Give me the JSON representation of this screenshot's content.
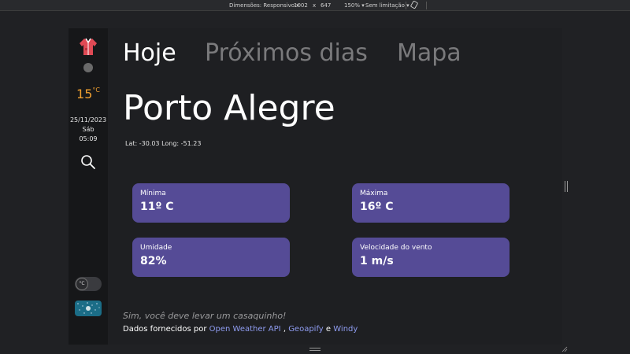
{
  "devtools": {
    "dimensions_label": "Dimensões: Responsivo",
    "width": "1002",
    "times": "x",
    "height": "647",
    "zoom": "150%",
    "throttle": "Sem limitação"
  },
  "sidebar": {
    "temperature": "15",
    "temperature_unit": "°C",
    "date": "25/11/2023",
    "weekday": "Sáb",
    "time": "05:09",
    "unit_toggle_label": "°C"
  },
  "tabs": [
    "Hoje",
    "Próximos dias",
    "Mapa"
  ],
  "location": {
    "city": "Porto Alegre",
    "coords": "Lat: -30.03 Long: -51.23"
  },
  "cards": {
    "min": {
      "label": "Mínima",
      "value": "11º C"
    },
    "max": {
      "label": "Máxima",
      "value": "16º C"
    },
    "humidity": {
      "label": "Umidade",
      "value": "82%"
    },
    "wind": {
      "label": "Velocidade do vento",
      "value": "1 m/s"
    }
  },
  "footer": {
    "tip": "Sim, você deve levar um casaquinho!",
    "credits_prefix": "Dados fornecidos por ",
    "link_owm": "Open Weather API",
    "sep1": " , ",
    "link_geoapify": "Geoapify",
    "sep2": " e ",
    "link_windy": "Windy"
  },
  "colors": {
    "accent_temp": "#f0a030",
    "card_bg": "#554b96",
    "link": "#8f9cf0"
  }
}
